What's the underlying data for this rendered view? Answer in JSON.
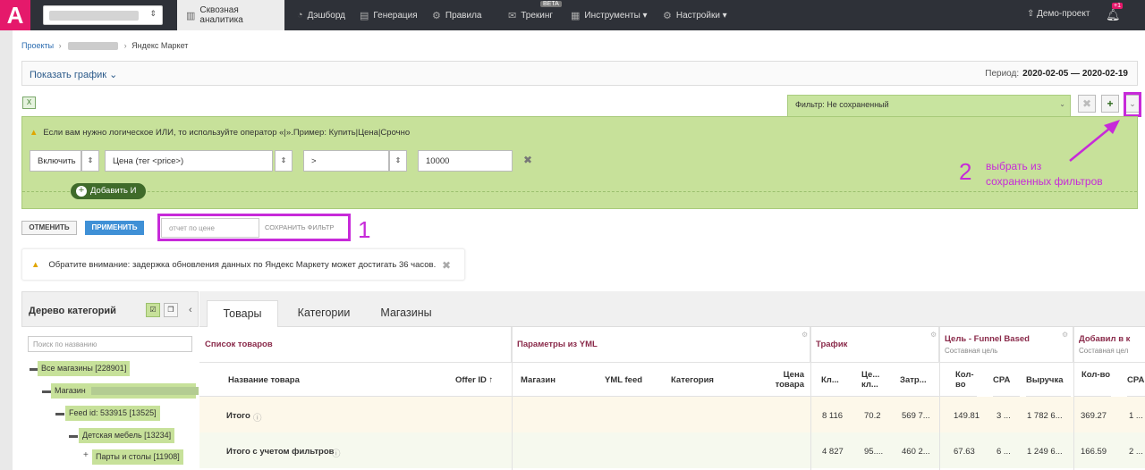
{
  "topbar": {
    "logo": "A",
    "project_caret": "⇕",
    "nav": [
      {
        "icon": "▥",
        "label": "Сквозная аналитика"
      },
      {
        "icon": "◔",
        "label": "Дэшборд"
      },
      {
        "icon": "▤",
        "label": "Генерация"
      },
      {
        "icon": "⚙",
        "label": "Правила"
      },
      {
        "icon": "✉",
        "label": "Трекинг"
      },
      {
        "icon": "▦",
        "label": "Инструменты ▾"
      },
      {
        "icon": "⚙",
        "label": "Настройки ▾"
      }
    ],
    "beta": "BETA",
    "demo": "⇧ Демо-проект",
    "badge": "+1"
  },
  "breadcrumbs": {
    "projects": "Проекты",
    "current": "Яндекс Маркет"
  },
  "chart_toggle": "Показать график ⌄",
  "period": {
    "label": "Период:",
    "value": "2020-02-05 — 2020-02-19"
  },
  "filter": {
    "tab_label": "Фильтр: Не сохраненный",
    "hint": "Если вам нужно логическое ИЛИ, то используйте оператор «|».Пример: Купить|Цена|Срочно",
    "include": "Включить",
    "field": "Цена (тег <price>)",
    "operator": ">",
    "value": "10000",
    "add_and": "Добавить И"
  },
  "actions": {
    "cancel": "ОТМЕНИТЬ",
    "apply": "ПРИМЕНИТЬ",
    "report_name_placeholder": "отчет по цене",
    "save_filter": "СОХРАНИТЬ ФИЛЬТР"
  },
  "annotations": {
    "n1": "1",
    "n2": "2",
    "text_line1": "выбрать из",
    "text_line2": "сохраненных фильтров"
  },
  "notice": "Обратите внимание: задержка обновления данных по Яндекс Маркету может достигать 36 часов.",
  "tree": {
    "title": "Дерево категорий",
    "search_placeholder": "Поиск по названию",
    "nodes": [
      "Все магазины [228901]",
      "Магазин",
      "Feed id: 533915 [13525]",
      "Детская мебель [13234]",
      "Парты и столы [11908]"
    ]
  },
  "tabs": [
    "Товары",
    "Категории",
    "Магазины"
  ],
  "table": {
    "groups": [
      {
        "title": "Список товаров",
        "sub": ""
      },
      {
        "title": "Параметры из YML",
        "sub": ""
      },
      {
        "title": "Трафик",
        "sub": ""
      },
      {
        "title": "Цель - Funnel Based",
        "sub": "Составная цель"
      },
      {
        "title": "Добавил в к",
        "sub": "Составная цел"
      }
    ],
    "headers": [
      "Название товара",
      "Offer ID",
      "Магазин",
      "YML feed",
      "Категория",
      "Цена товара",
      "Кл...",
      "Це... кл...",
      "Затр...",
      "Кол-во",
      "CPA",
      "Выручка",
      "Кол-во",
      "CPA"
    ],
    "rows": [
      {
        "name": "Итого",
        "values": [
          "8 116",
          "70.2",
          "569 7...",
          "149.81",
          "3 ...",
          "1 782 6...",
          "369.27",
          "1 ..."
        ]
      },
      {
        "name": "Итого с учетом фильтров",
        "values": [
          "4 827",
          "95....",
          "460 2...",
          "67.63",
          "6 ...",
          "1 249 6...",
          "166.59",
          "2 ..."
        ]
      }
    ]
  }
}
